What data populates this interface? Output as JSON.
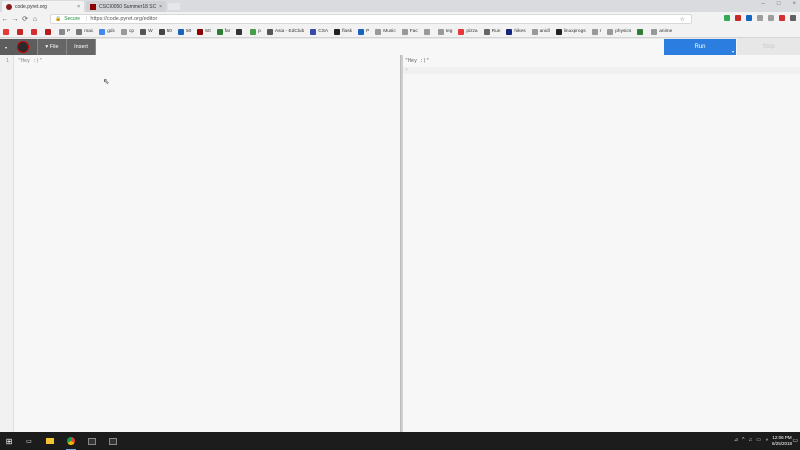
{
  "browser": {
    "tabs": [
      {
        "title": "code.pyret.org",
        "close": "×",
        "active": true
      },
      {
        "title": "CSCI0050 Summer18 SC",
        "close": "×",
        "active": false
      }
    ],
    "window_controls": [
      "–",
      "□",
      "×"
    ],
    "nav": {
      "back": "←",
      "forward": "→",
      "reload": "⟳",
      "home": "⌂"
    },
    "secure_label": "Secure",
    "url": "https://code.pyret.org/editor",
    "star": "☆"
  },
  "bookmarks": [
    {
      "label": "",
      "color": "#e53935"
    },
    {
      "label": "",
      "color": "#c62828"
    },
    {
      "label": "",
      "color": "#d32f2f"
    },
    {
      "label": "",
      "color": "#b71c1c"
    },
    {
      "label": "P",
      "color": "#888888"
    },
    {
      "label": "mac",
      "color": "#777777"
    },
    {
      "label": "gdc",
      "color": "#4285f4"
    },
    {
      "label": "cp",
      "color": "#999999"
    },
    {
      "label": "W",
      "color": "#555555"
    },
    {
      "label": "50",
      "color": "#444444"
    },
    {
      "label": "50",
      "color": "#1565c0"
    },
    {
      "label": "50",
      "color": "#8b0000"
    },
    {
      "label": "far",
      "color": "#2e7d32"
    },
    {
      "label": "",
      "color": "#333333"
    },
    {
      "label": "p",
      "color": "#43a047"
    },
    {
      "label": "Asia - EdClub",
      "color": "#555555"
    },
    {
      "label": "CSA",
      "color": "#3949ab"
    },
    {
      "label": "flask",
      "color": "#222222"
    },
    {
      "label": "P",
      "color": "#1565c0"
    },
    {
      "label": "Music",
      "color": "#999999"
    },
    {
      "label": "Fac",
      "color": "#999999"
    },
    {
      "label": "",
      "color": "#999999"
    },
    {
      "label": "teg",
      "color": "#999999"
    },
    {
      "label": "pizza",
      "color": "#e53935"
    },
    {
      "label": "Run",
      "color": "#666666"
    },
    {
      "label": "hikes",
      "color": "#1a237e"
    },
    {
      "label": "anidl",
      "color": "#999999"
    },
    {
      "label": "linuxprogs",
      "color": "#222222"
    },
    {
      "label": "r",
      "color": "#999999"
    },
    {
      "label": "physics",
      "color": "#999999"
    },
    {
      "label": "",
      "color": "#2e7d32"
    },
    {
      "label": "anime",
      "color": "#999999"
    }
  ],
  "pyret": {
    "file_label": "▾ File",
    "insert_label": "Insert",
    "logo_drop": "▾",
    "run_label": "Run",
    "run_drop": "▾",
    "stop_label": "Stop"
  },
  "editor": {
    "line_number": "1",
    "code": "\"Hey :)\""
  },
  "repl": {
    "output": "\"Hey :)\"",
    "prompt": "›"
  },
  "taskbar": {
    "start": "⊞",
    "tray": [
      "⊿",
      "^",
      "♫",
      "▭",
      "◑"
    ],
    "time": "12:06 PM",
    "date": "6/25/2018",
    "notif": "▭"
  },
  "colors": {
    "run_button": "#2b7de0",
    "pyret_toolbar": "#666666",
    "taskbar": "#1c1c1c"
  }
}
